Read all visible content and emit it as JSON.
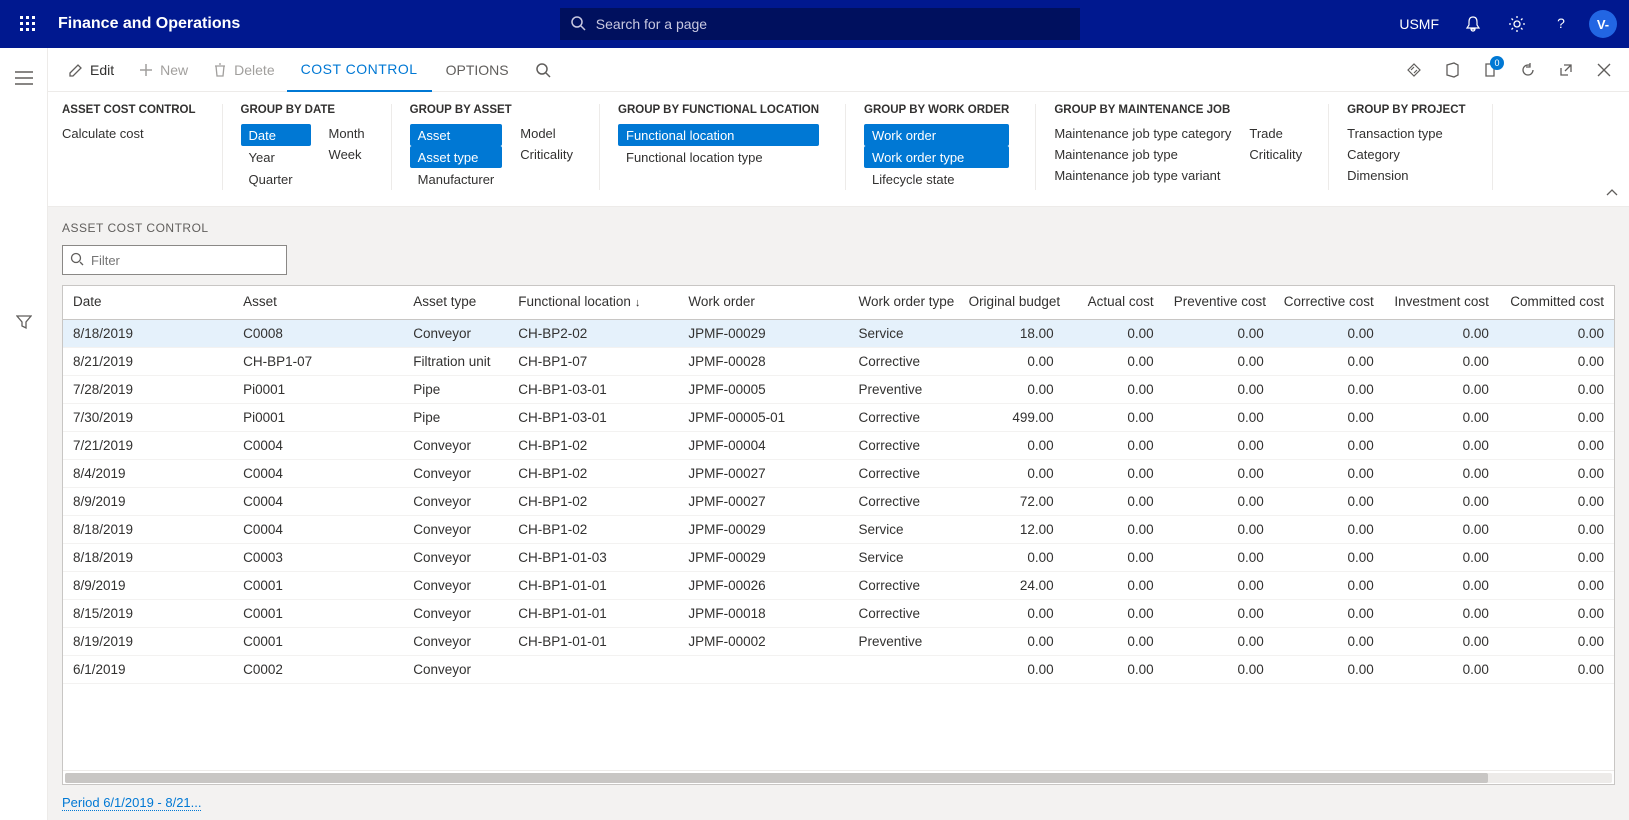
{
  "nav": {
    "title": "Finance and Operations",
    "search_placeholder": "Search for a page",
    "company": "USMF",
    "avatar_initial": "V-"
  },
  "action_bar": {
    "edit": "Edit",
    "new": "New",
    "delete": "Delete",
    "tabs": {
      "cost_control": "COST CONTROL",
      "options": "OPTIONS"
    },
    "notif_count": "0"
  },
  "groups": {
    "asset_cost_control": {
      "heading": "ASSET COST CONTROL",
      "calc": "Calculate cost"
    },
    "by_date": {
      "heading": "GROUP BY DATE",
      "date": "Date",
      "year": "Year",
      "quarter": "Quarter",
      "month": "Month",
      "week": "Week"
    },
    "by_asset": {
      "heading": "GROUP BY ASSET",
      "asset": "Asset",
      "asset_type": "Asset type",
      "manufacturer": "Manufacturer",
      "model": "Model",
      "criticality": "Criticality"
    },
    "by_loc": {
      "heading": "GROUP BY FUNCTIONAL LOCATION",
      "func_loc": "Functional location",
      "func_loc_type": "Functional location type"
    },
    "by_wo": {
      "heading": "GROUP BY WORK ORDER",
      "wo": "Work order",
      "wo_type": "Work order type",
      "lifecycle": "Lifecycle state"
    },
    "by_job": {
      "heading": "GROUP BY MAINTENANCE JOB",
      "cat": "Maintenance job type category",
      "type": "Maintenance job type",
      "variant": "Maintenance job type variant",
      "trade": "Trade",
      "criticality": "Criticality"
    },
    "by_project": {
      "heading": "GROUP BY PROJECT",
      "txtype": "Transaction type",
      "category": "Category",
      "dimension": "Dimension"
    }
  },
  "page": {
    "section_title": "ASSET COST CONTROL",
    "filter_placeholder": "Filter",
    "footer": "Period 6/1/2019 - 8/21..."
  },
  "columns": {
    "date": "Date",
    "asset": "Asset",
    "asset_type": "Asset type",
    "func_loc": "Functional location",
    "work_order": "Work order",
    "wo_type": "Work order type",
    "orig_budget": "Original budget",
    "actual": "Actual cost",
    "preventive": "Preventive cost",
    "corrective": "Corrective cost",
    "investment": "Investment cost",
    "committed": "Committed cost"
  },
  "rows": [
    {
      "date": "8/18/2019",
      "asset": "C0008",
      "asset_type": "Conveyor",
      "func_loc": "CH-BP2-02",
      "work_order": "JPMF-00029",
      "wo_type": "Service",
      "orig_budget": "18.00",
      "actual": "0.00",
      "preventive": "0.00",
      "corrective": "0.00",
      "investment": "0.00",
      "committed": "0.00"
    },
    {
      "date": "8/21/2019",
      "asset": "CH-BP1-07",
      "asset_type": "Filtration unit",
      "func_loc": "CH-BP1-07",
      "work_order": "JPMF-00028",
      "wo_type": "Corrective",
      "orig_budget": "0.00",
      "actual": "0.00",
      "preventive": "0.00",
      "corrective": "0.00",
      "investment": "0.00",
      "committed": "0.00"
    },
    {
      "date": "7/28/2019",
      "asset": "Pi0001",
      "asset_type": "Pipe",
      "func_loc": "CH-BP1-03-01",
      "work_order": "JPMF-00005",
      "wo_type": "Preventive",
      "orig_budget": "0.00",
      "actual": "0.00",
      "preventive": "0.00",
      "corrective": "0.00",
      "investment": "0.00",
      "committed": "0.00"
    },
    {
      "date": "7/30/2019",
      "asset": "Pi0001",
      "asset_type": "Pipe",
      "func_loc": "CH-BP1-03-01",
      "work_order": "JPMF-00005-01",
      "wo_type": "Corrective",
      "orig_budget": "499.00",
      "actual": "0.00",
      "preventive": "0.00",
      "corrective": "0.00",
      "investment": "0.00",
      "committed": "0.00"
    },
    {
      "date": "7/21/2019",
      "asset": "C0004",
      "asset_type": "Conveyor",
      "func_loc": "CH-BP1-02",
      "work_order": "JPMF-00004",
      "wo_type": "Corrective",
      "orig_budget": "0.00",
      "actual": "0.00",
      "preventive": "0.00",
      "corrective": "0.00",
      "investment": "0.00",
      "committed": "0.00"
    },
    {
      "date": "8/4/2019",
      "asset": "C0004",
      "asset_type": "Conveyor",
      "func_loc": "CH-BP1-02",
      "work_order": "JPMF-00027",
      "wo_type": "Corrective",
      "orig_budget": "0.00",
      "actual": "0.00",
      "preventive": "0.00",
      "corrective": "0.00",
      "investment": "0.00",
      "committed": "0.00"
    },
    {
      "date": "8/9/2019",
      "asset": "C0004",
      "asset_type": "Conveyor",
      "func_loc": "CH-BP1-02",
      "work_order": "JPMF-00027",
      "wo_type": "Corrective",
      "orig_budget": "72.00",
      "actual": "0.00",
      "preventive": "0.00",
      "corrective": "0.00",
      "investment": "0.00",
      "committed": "0.00"
    },
    {
      "date": "8/18/2019",
      "asset": "C0004",
      "asset_type": "Conveyor",
      "func_loc": "CH-BP1-02",
      "work_order": "JPMF-00029",
      "wo_type": "Service",
      "orig_budget": "12.00",
      "actual": "0.00",
      "preventive": "0.00",
      "corrective": "0.00",
      "investment": "0.00",
      "committed": "0.00"
    },
    {
      "date": "8/18/2019",
      "asset": "C0003",
      "asset_type": "Conveyor",
      "func_loc": "CH-BP1-01-03",
      "work_order": "JPMF-00029",
      "wo_type": "Service",
      "orig_budget": "0.00",
      "actual": "0.00",
      "preventive": "0.00",
      "corrective": "0.00",
      "investment": "0.00",
      "committed": "0.00"
    },
    {
      "date": "8/9/2019",
      "asset": "C0001",
      "asset_type": "Conveyor",
      "func_loc": "CH-BP1-01-01",
      "work_order": "JPMF-00026",
      "wo_type": "Corrective",
      "orig_budget": "24.00",
      "actual": "0.00",
      "preventive": "0.00",
      "corrective": "0.00",
      "investment": "0.00",
      "committed": "0.00"
    },
    {
      "date": "8/15/2019",
      "asset": "C0001",
      "asset_type": "Conveyor",
      "func_loc": "CH-BP1-01-01",
      "work_order": "JPMF-00018",
      "wo_type": "Corrective",
      "orig_budget": "0.00",
      "actual": "0.00",
      "preventive": "0.00",
      "corrective": "0.00",
      "investment": "0.00",
      "committed": "0.00"
    },
    {
      "date": "8/19/2019",
      "asset": "C0001",
      "asset_type": "Conveyor",
      "func_loc": "CH-BP1-01-01",
      "work_order": "JPMF-00002",
      "wo_type": "Preventive",
      "orig_budget": "0.00",
      "actual": "0.00",
      "preventive": "0.00",
      "corrective": "0.00",
      "investment": "0.00",
      "committed": "0.00"
    },
    {
      "date": "6/1/2019",
      "asset": "C0002",
      "asset_type": "Conveyor",
      "func_loc": "",
      "work_order": "",
      "wo_type": "",
      "orig_budget": "0.00",
      "actual": "0.00",
      "preventive": "0.00",
      "corrective": "0.00",
      "investment": "0.00",
      "committed": "0.00"
    }
  ]
}
